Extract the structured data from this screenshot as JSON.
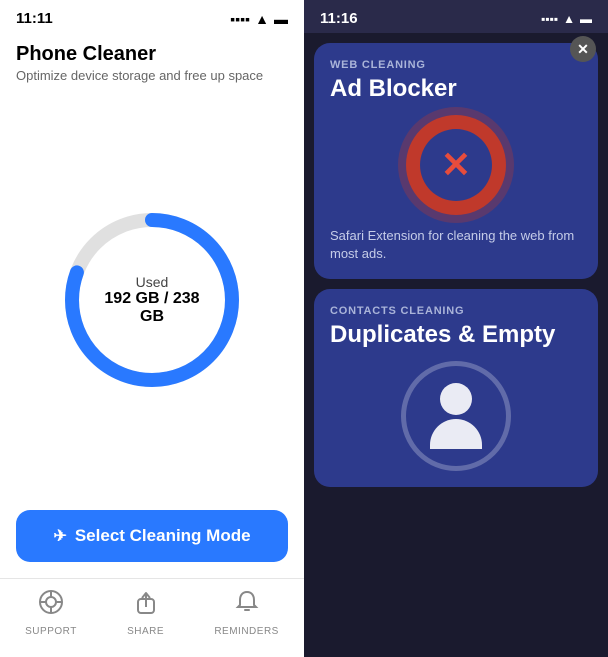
{
  "left": {
    "status_bar": {
      "time": "11:11"
    },
    "app": {
      "title": "Phone Cleaner",
      "subtitle": "Optimize device storage and free up space"
    },
    "storage": {
      "label_used": "Used",
      "value": "192 GB / 238 GB",
      "used_gb": 192,
      "total_gb": 238,
      "used_percent": 80.67
    },
    "select_button": {
      "label": "Select Cleaning Mode",
      "icon": "✈"
    },
    "nav": {
      "items": [
        {
          "label": "SUPPORT",
          "icon": "⊙"
        },
        {
          "label": "SHARE",
          "icon": "↑"
        },
        {
          "label": "REMINDERS",
          "icon": "🔔"
        }
      ]
    }
  },
  "right": {
    "status_bar": {
      "time": "11:16"
    },
    "card1": {
      "category": "WEB CLEANING",
      "title": "Ad Blocker",
      "description": "Safari Extension for cleaning the web from most ads."
    },
    "card2": {
      "category": "CONTACTS CLEANING",
      "title": "Duplicates & Empty"
    },
    "close_button": "✕",
    "colors": {
      "background": "#1a1a2e",
      "card_bg": "#2d3a8c",
      "accent_red": "#c0392b"
    }
  }
}
